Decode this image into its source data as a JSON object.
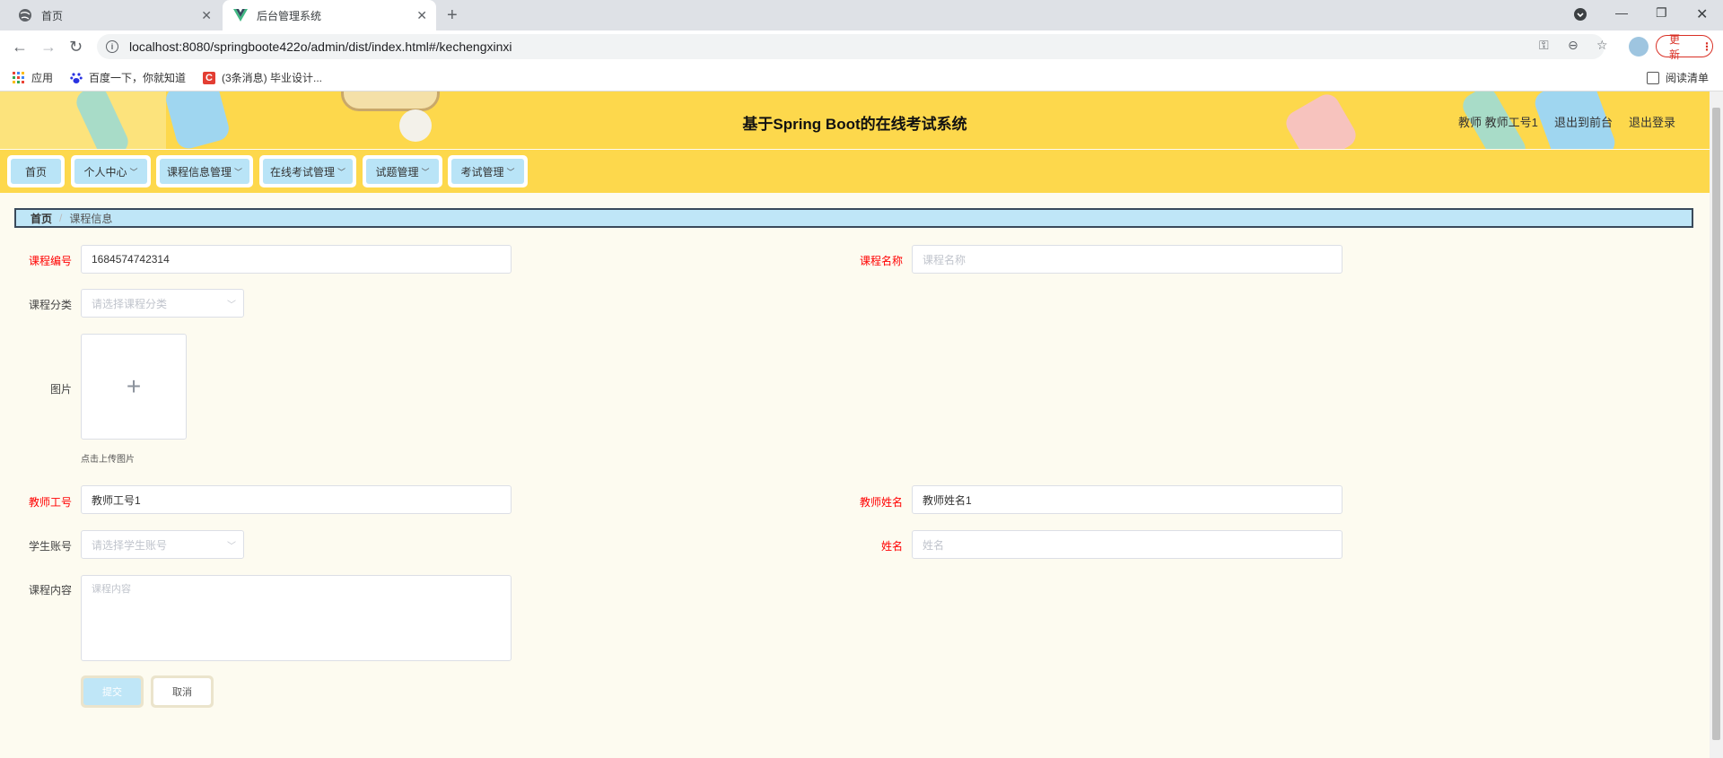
{
  "browser": {
    "tabs": [
      {
        "label": "首页",
        "icon": "globe-icon"
      },
      {
        "label": "后台管理系统",
        "icon": "vue-logo-icon"
      }
    ],
    "url": "localhost:8080/springboote422o/admin/dist/index.html#/kechengxinxi",
    "update_label": "更新",
    "bookmarks": [
      {
        "label": "应用",
        "icon": "apps-grid-icon"
      },
      {
        "label": "百度一下，你就知道",
        "icon": "baidu-paw-icon"
      },
      {
        "label": "(3条消息) 毕业设计...",
        "icon": "csdn-icon"
      }
    ],
    "reading_list": "阅读清单"
  },
  "header": {
    "title": "基于Spring Boot的在线考试系统",
    "user": "教师 教师工号1",
    "exit_front": "退出到前台",
    "logout": "退出登录"
  },
  "menu": {
    "items": [
      {
        "label": "首页",
        "has_dropdown": false
      },
      {
        "label": "个人中心",
        "has_dropdown": true
      },
      {
        "label": "课程信息管理",
        "has_dropdown": true
      },
      {
        "label": "在线考试管理",
        "has_dropdown": true
      },
      {
        "label": "试题管理",
        "has_dropdown": true
      },
      {
        "label": "考试管理",
        "has_dropdown": true
      }
    ]
  },
  "breadcrumb": {
    "home": "首页",
    "current": "课程信息"
  },
  "form": {
    "course_no": {
      "label": "课程编号",
      "value": "1684574742314"
    },
    "course_name": {
      "label": "课程名称",
      "placeholder": "课程名称"
    },
    "course_category": {
      "label": "课程分类",
      "placeholder": "请选择课程分类"
    },
    "image": {
      "label": "图片",
      "hint": "点击上传图片"
    },
    "teacher_no": {
      "label": "教师工号",
      "value": "教师工号1"
    },
    "teacher_name": {
      "label": "教师姓名",
      "value": "教师姓名1"
    },
    "student_account": {
      "label": "学生账号",
      "placeholder": "请选择学生账号"
    },
    "name": {
      "label": "姓名",
      "placeholder": "姓名"
    },
    "course_content": {
      "label": "课程内容",
      "placeholder": "课程内容"
    },
    "submit_label": "提交",
    "cancel_label": "取消"
  },
  "colors": {
    "header_bg": "#fdd84c",
    "menu_item_bg": "#b9e4f7",
    "required_label": "#ff0000",
    "page_bg": "#fdfbf0"
  }
}
